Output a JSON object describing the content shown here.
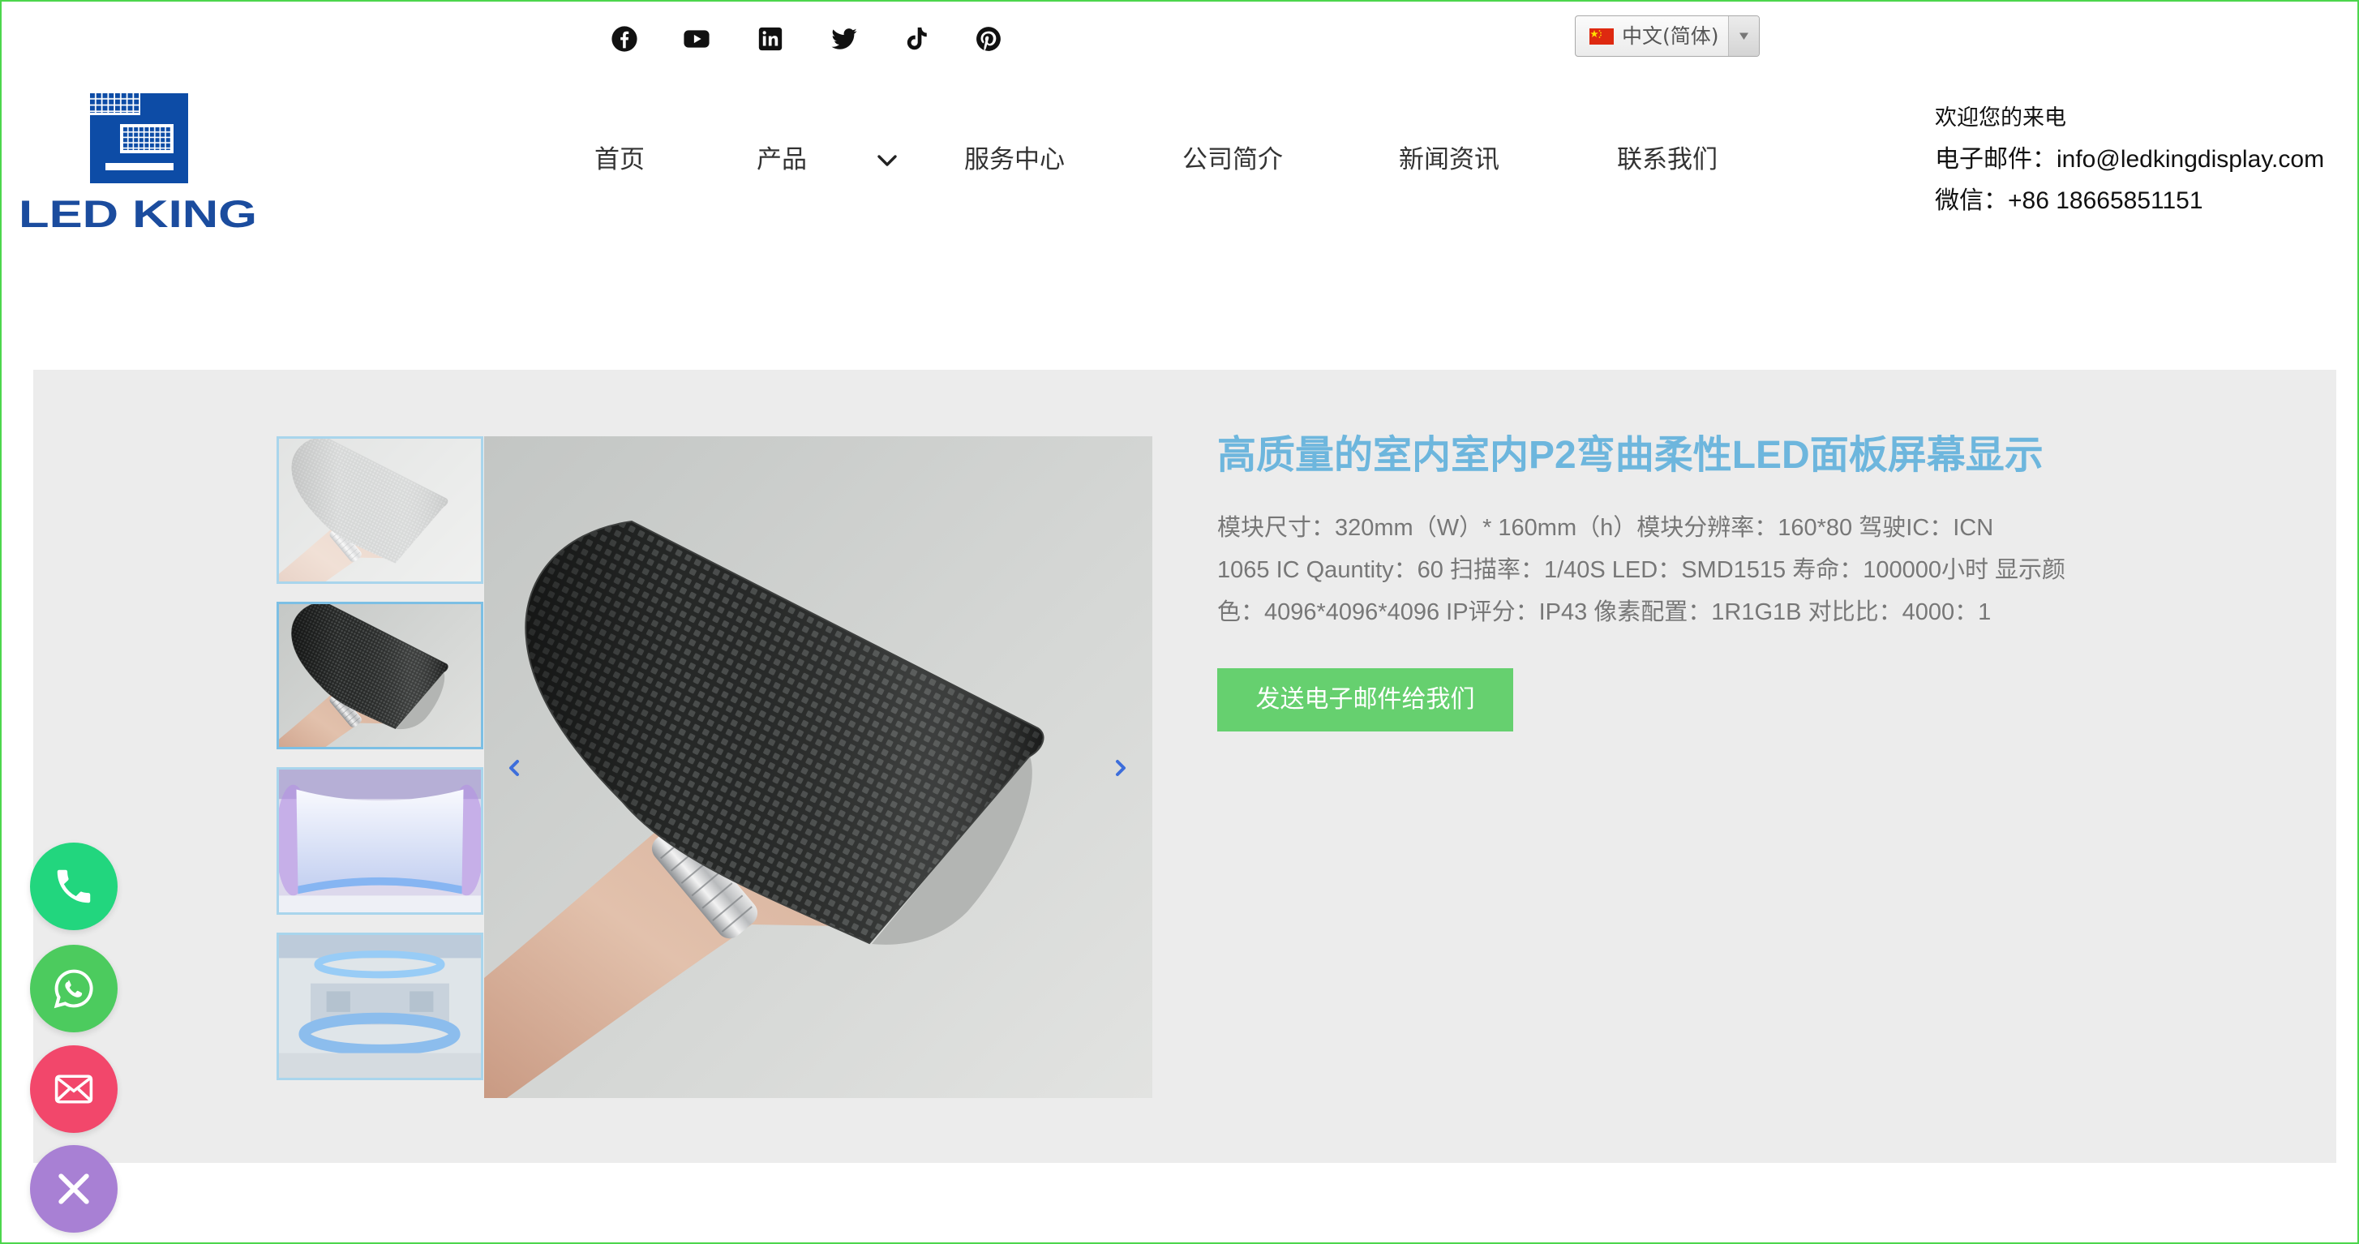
{
  "colors": {
    "page_border": "#4cd64c",
    "title": "#6db6dd",
    "cta": "#66d06f",
    "logo": "#1b4c9e",
    "section_bg": "#ececec",
    "thumbnail_border": "#a9d5ec",
    "gallery_arrow": "#3d6edb"
  },
  "header": {
    "social_icons": [
      "facebook-icon",
      "youtube-icon",
      "linkedin-icon",
      "twitter-icon",
      "tiktok-icon",
      "pinterest-icon"
    ],
    "language": {
      "flag_icon": "china-flag-icon",
      "label": "中文(简体)",
      "arrow_icon": "dropdown-arrow-icon"
    },
    "logo": {
      "text": "LED KING"
    },
    "nav": [
      {
        "label": "首页"
      },
      {
        "label": "产品",
        "dropdown_icon": "chevron-down-icon"
      },
      {
        "label": "服务中心"
      },
      {
        "label": "公司简介"
      },
      {
        "label": "新闻资讯"
      },
      {
        "label": "联系我们"
      }
    ],
    "contact": {
      "welcome": "欢迎您的来电",
      "email": "电子邮件：info@ledkingdisplay.com",
      "wechat": "微信：+86 18665851151"
    }
  },
  "product": {
    "title": "高质量的室内室内P2弯曲柔性LED面板屏幕显示",
    "description_lines": [
      "模块尺寸：320mm（W）* 160mm（h）模块分辨率：160*80 驾驶IC：ICN",
      "1065 IC Qauntity：60 扫描率：1/40S LED：SMD1515 寿命：100000小时 显示颜",
      "色：4096*4096*4096 IP评分：IP43 像素配置：1R1G1B 对比比：4000：1"
    ],
    "cta_label": "发送电子邮件给我们",
    "gallery": {
      "active_thumbnail": 2,
      "prev_icon": "chevron-left-icon",
      "next_icon": "chevron-right-icon"
    }
  },
  "floating_buttons": [
    {
      "icon": "phone-icon",
      "color": "#22d67e"
    },
    {
      "icon": "whatsapp-icon",
      "color": "#4ccb5e"
    },
    {
      "icon": "email-icon",
      "color": "#f2476b"
    },
    {
      "icon": "close-icon",
      "color": "#a880d4"
    }
  ]
}
